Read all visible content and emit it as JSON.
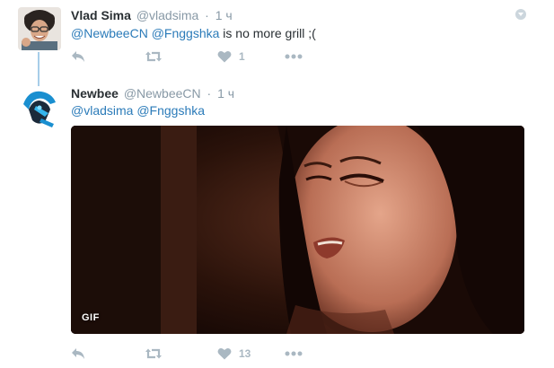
{
  "tweets": [
    {
      "fullname": "Vlad Sima",
      "handle": "@vladsima",
      "separator": "·",
      "time": "1 ч",
      "text_parts": {
        "mention1": "@NewbeeCN",
        "mention2": "@Fnggshka",
        "rest": " is no more grill ;("
      },
      "actions": {
        "reply_icon": "reply-icon",
        "retweet_icon": "retweet-icon",
        "like_icon": "heart-icon",
        "like_count": "1",
        "more_icon": "more-icon"
      }
    },
    {
      "fullname": "Newbee",
      "handle": "@NewbeeCN",
      "separator": "·",
      "time": "1 ч",
      "text_parts": {
        "mention1": "@vladsima",
        "mention2": "@Fnggshka"
      },
      "media": {
        "badge": "GIF"
      },
      "actions": {
        "reply_icon": "reply-icon",
        "retweet_icon": "retweet-icon",
        "like_icon": "heart-icon",
        "like_count": "13",
        "more_icon": "more-icon"
      }
    }
  ],
  "colors": {
    "link": "#2b7bb9",
    "muted": "#8899a6",
    "action": "#aab8c2",
    "thread": "#a7cde9"
  }
}
